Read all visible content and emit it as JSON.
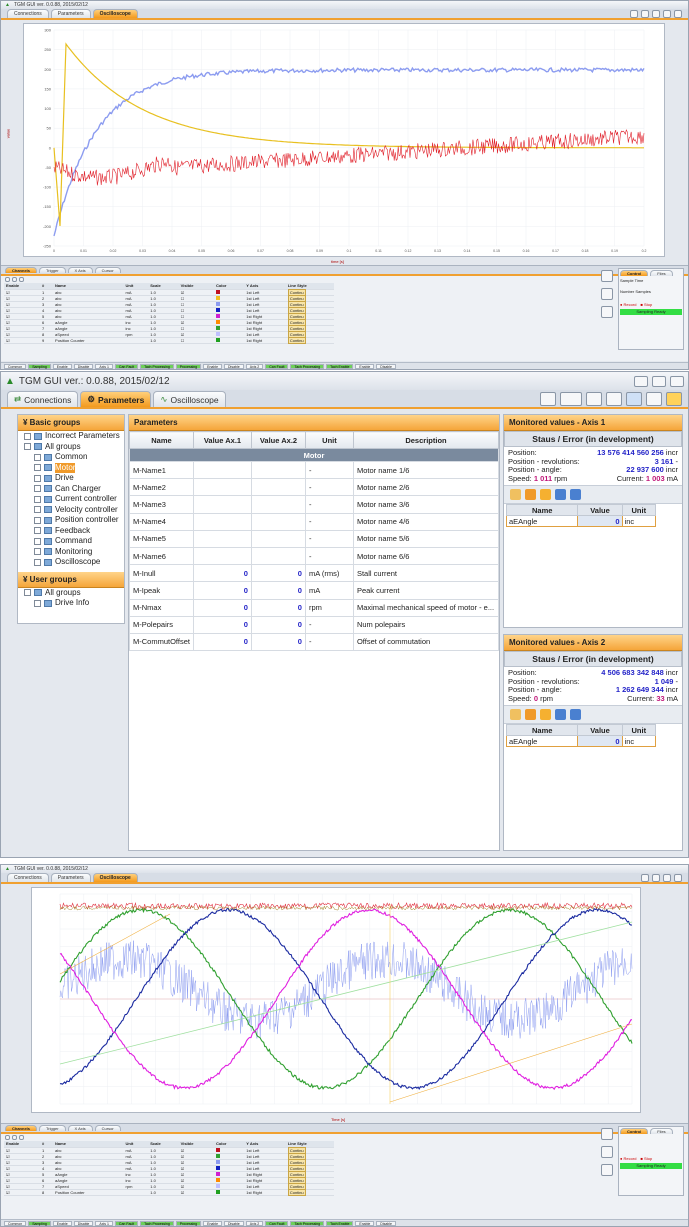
{
  "top_window": {
    "title": "TGM GUI ver. 0.0.88, 2015/02/12",
    "tabs": [
      "Connections",
      "Parameters",
      "Oscilloscope"
    ],
    "active_tab": "Oscilloscope",
    "plot": {
      "x_label": "time [s]",
      "y_label": "value",
      "y_ticks": [
        "300",
        "250",
        "200",
        "150",
        "100",
        "50",
        "0",
        "-50",
        "-100",
        "-150",
        "-200",
        "-250"
      ],
      "x_ticks": [
        "0",
        "0.01",
        "0.02",
        "0.03",
        "0.04",
        "0.05",
        "0.06",
        "0.07",
        "0.08",
        "0.09",
        "0.1",
        "0.11",
        "0.12",
        "0.13",
        "0.14",
        "0.15",
        "0.16",
        "0.17",
        "0.18",
        "0.19",
        "0.2"
      ],
      "series_colors": {
        "blue": "#8c9cf0",
        "red": "#e0202a",
        "yellow": "#e8c020"
      }
    },
    "bottom_tabs": [
      "Channels",
      "Trigger",
      "X Axis",
      "Cursor"
    ],
    "channel_table": {
      "headers": [
        "Enable",
        "#",
        "Name",
        "Unit",
        "Scale",
        "Visible",
        "Color",
        "Y Axis",
        "Line Style"
      ],
      "rows": [
        [
          "☑",
          "1",
          "abc",
          "mA",
          "1.0",
          "☑",
          "#c01020",
          "1st Left",
          "Continu"
        ],
        [
          "☑",
          "2",
          "abc",
          "mA",
          "1.0",
          "☐",
          "#f0c020",
          "1st Left",
          "Continu"
        ],
        [
          "☑",
          "3",
          "abc",
          "mA",
          "1.0",
          "☐",
          "#8c9cf0",
          "1st Left",
          "Continu"
        ],
        [
          "☑",
          "4",
          "abc",
          "mA",
          "1.0",
          "☐",
          "#1020c0",
          "1st Left",
          "Continu"
        ],
        [
          "☑",
          "5",
          "abc",
          "mA",
          "1.0",
          "☐",
          "#d020d0",
          "1st Right",
          "Continu"
        ],
        [
          "☑",
          "6",
          "aAngle",
          "inc",
          "1.0",
          "☑",
          "#ff8c00",
          "1st Right",
          "Continu"
        ],
        [
          "☑",
          "7",
          "aAngle",
          "inc",
          "1.0",
          "☐",
          "#30a030",
          "1st Right",
          "Continu"
        ],
        [
          "☑",
          "8",
          "aSpeed",
          "rpm",
          "1.0",
          "☑",
          "#c0c0ff",
          "1st Left",
          "Continu"
        ],
        [
          "☑",
          "9",
          "Position Counter",
          "",
          "1.0",
          "☐",
          "#20a020",
          "1st Right",
          "Continu"
        ]
      ]
    },
    "control": {
      "tabs": [
        "Control",
        "Files"
      ],
      "sample_time": "Sample Time",
      "number_samples": "Number Samples",
      "record": "Record",
      "stop": "Stop",
      "status": "Sampling Ready"
    },
    "status_bar": [
      "Common",
      "Sampling",
      "Enable",
      "Disable",
      "Axis 1",
      "Can Fault",
      "Tach Processing",
      "Processing",
      "Enable",
      "Disable",
      "Axis 2",
      "Can Fault",
      "Tach Processing",
      "Tach Enable",
      "Enable",
      "Disable"
    ]
  },
  "params_window": {
    "title": "TGM GUI  ver.: 0.0.88,  2015/02/12",
    "tabs": [
      "Connections",
      "Parameters",
      "Oscilloscope"
    ],
    "active_tab": "Parameters",
    "basic_groups_title": "Basic groups",
    "basic_groups": [
      "Incorrect Parameters",
      "All groups",
      "Common",
      "Motor",
      "Drive",
      "Can Charger",
      "Current controller",
      "Velocity controller",
      "Position controller",
      "Feedback",
      "Command",
      "Monitoring",
      "Oscilloscope"
    ],
    "selected_group": "Motor",
    "user_groups_title": "User groups",
    "user_groups": [
      "All groups",
      "Drive Info"
    ],
    "params_title": "Parameters",
    "params_headers": [
      "Name",
      "Value Ax.1",
      "Value Ax.2",
      "Unit",
      "Description"
    ],
    "params_group_row": "Motor",
    "params_rows": [
      {
        "name": "M-Name1",
        "v1": "",
        "v2": "",
        "unit": "-",
        "desc": "Motor name 1/6"
      },
      {
        "name": "M-Name2",
        "v1": "",
        "v2": "",
        "unit": "-",
        "desc": "Motor name 2/6"
      },
      {
        "name": "M-Name3",
        "v1": "",
        "v2": "",
        "unit": "-",
        "desc": "Motor name 3/6"
      },
      {
        "name": "M-Name4",
        "v1": "",
        "v2": "",
        "unit": "-",
        "desc": "Motor name 4/6"
      },
      {
        "name": "M-Name5",
        "v1": "",
        "v2": "",
        "unit": "-",
        "desc": "Motor name 5/6"
      },
      {
        "name": "M-Name6",
        "v1": "",
        "v2": "",
        "unit": "-",
        "desc": "Motor name 6/6"
      },
      {
        "name": "M-Inull",
        "v1": "0",
        "v2": "0",
        "unit": "mA (rms)",
        "desc": "Stall current"
      },
      {
        "name": "M-Ipeak",
        "v1": "0",
        "v2": "0",
        "unit": "mA",
        "desc": "Peak current"
      },
      {
        "name": "M-Nmax",
        "v1": "0",
        "v2": "0",
        "unit": "rpm",
        "desc": "Maximal mechanical speed of motor - e..."
      },
      {
        "name": "M-Polepairs",
        "v1": "0",
        "v2": "0",
        "unit": "-",
        "desc": "Num polepairs"
      },
      {
        "name": "M-CommutOffset",
        "v1": "0",
        "v2": "0",
        "unit": "-",
        "desc": "Offset of commutation"
      }
    ],
    "axis1": {
      "title": "Monitored values - Axis 1",
      "staus": "Staus / Error  (in development)",
      "position_label": "Position:",
      "position": "13 576 414 560 256",
      "position_unit": "incr",
      "rev_label": "Position - revolutions:",
      "rev": "3 161",
      "rev_unit": "-",
      "angle_label": "Position - angle:",
      "angle": "22 937 600",
      "angle_unit": "incr",
      "speed_label": "Speed:",
      "speed": "1 011",
      "speed_unit": "rpm",
      "current_label": "Current:",
      "current": "1 003",
      "current_unit": "mA",
      "table_headers": [
        "Name",
        "Value",
        "Unit"
      ],
      "row": {
        "name": "aEAngle",
        "value": "0",
        "unit": "inc"
      }
    },
    "axis2": {
      "title": "Monitored values - Axis 2",
      "staus": "Staus / Error  (in development)",
      "position_label": "Position:",
      "position": "4 506 683 342 848",
      "position_unit": "incr",
      "rev_label": "Position - revolutions:",
      "rev": "1 049",
      "rev_unit": "-",
      "angle_label": "Position - angle:",
      "angle": "1 262 649 344",
      "angle_unit": "incr",
      "speed_label": "Speed:",
      "speed": "0",
      "speed_unit": "rpm",
      "current_label": "Current:",
      "current": "33",
      "current_unit": "mA",
      "table_headers": [
        "Name",
        "Value",
        "Unit"
      ],
      "row": {
        "name": "aEAngle",
        "value": "0",
        "unit": "inc"
      }
    }
  },
  "bottom_window": {
    "title": "TGM GUI ver. 0.0.88, 2015/02/12",
    "tabs": [
      "Connections",
      "Parameters",
      "Oscilloscope"
    ],
    "active_tab": "Oscilloscope",
    "plot": {
      "x_label": "Time [s]",
      "series_colors": {
        "red": "#e03040",
        "green": "#30a030",
        "blue": "#1a2aa0",
        "magenta": "#e020e0",
        "lightblue": "#8c9cf0",
        "olive": "#a08020",
        "orange": "#f0b040"
      }
    },
    "bottom_tabs": [
      "Channels",
      "Trigger",
      "X Axis",
      "Cursor"
    ],
    "channel_table": {
      "headers": [
        "Enable",
        "#",
        "Name",
        "Unit",
        "Scale",
        "Visible",
        "Color",
        "Y Axis",
        "Line Style"
      ],
      "rows": [
        [
          "☑",
          "1",
          "abc",
          "mA",
          "1.0",
          "☑",
          "#c01020",
          "1st Left",
          "Continu"
        ],
        [
          "☑",
          "2",
          "abc",
          "mA",
          "1.0",
          "☑",
          "#30a030",
          "1st Left",
          "Continu"
        ],
        [
          "☑",
          "3",
          "abc",
          "mA",
          "1.0",
          "☑",
          "#8c9cf0",
          "1st Left",
          "Continu"
        ],
        [
          "☑",
          "4",
          "abc",
          "mA",
          "1.0",
          "☑",
          "#1020c0",
          "1st Left",
          "Continu"
        ],
        [
          "☑",
          "5",
          "aAngle",
          "inc",
          "1.0",
          "☑",
          "#d020d0",
          "1st Right",
          "Continu"
        ],
        [
          "☑",
          "6",
          "aAngle",
          "inc",
          "1.0",
          "☑",
          "#ff8c00",
          "1st Right",
          "Continu"
        ],
        [
          "☑",
          "7",
          "aSpeed",
          "rpm",
          "1.0",
          "☑",
          "#c0c0ff",
          "1st Left",
          "Continu"
        ],
        [
          "☑",
          "8",
          "Position Counter",
          "",
          "1.0",
          "☑",
          "#20a020",
          "1st Right",
          "Continu"
        ]
      ]
    },
    "control": {
      "tabs": [
        "Control",
        "Files"
      ],
      "record": "Record",
      "stop": "Stop",
      "status": "Sampling Ready"
    },
    "status_bar": [
      "Common",
      "Sampling",
      "Enable",
      "Disable",
      "Axis 1",
      "Can Fault",
      "Tach Processing",
      "Processing",
      "Enable",
      "Disable",
      "Axis 2",
      "Can Fault",
      "Tach Processing",
      "Tach Enable",
      "Enable",
      "Disable"
    ]
  }
}
